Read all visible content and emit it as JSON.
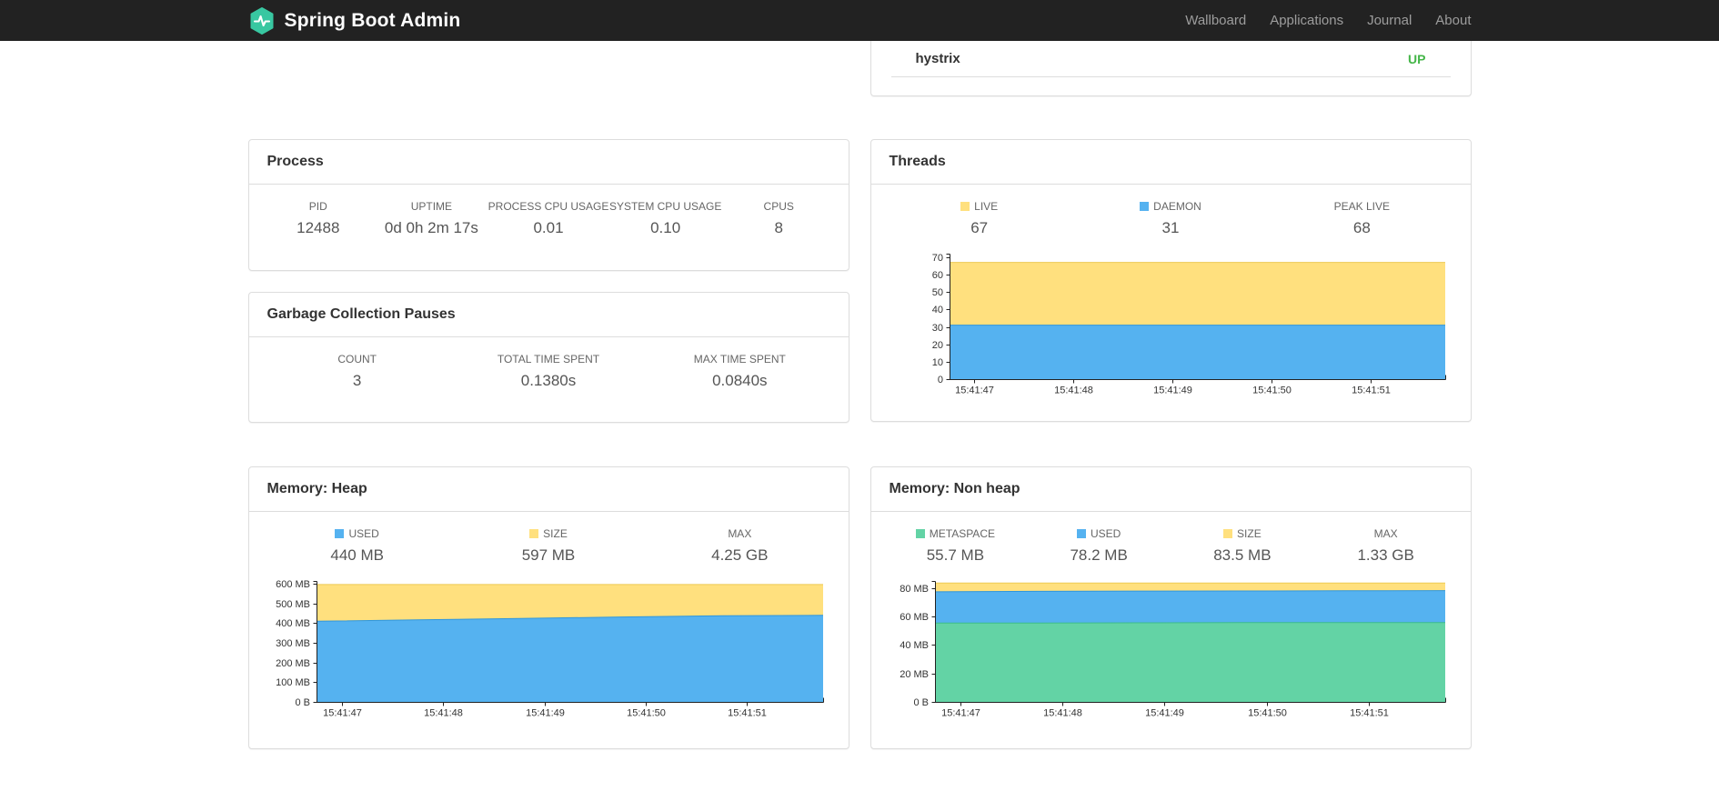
{
  "navbar": {
    "brand": "Spring Boot Admin",
    "items": [
      {
        "label": "Wallboard"
      },
      {
        "label": "Applications"
      },
      {
        "label": "Journal"
      },
      {
        "label": "About"
      }
    ]
  },
  "applications_panel": {
    "app_name": "hystrix",
    "status": "UP"
  },
  "panels": {
    "process": {
      "title": "Process",
      "metrics": [
        {
          "label": "PID",
          "value": "12488"
        },
        {
          "label": "UPTIME",
          "value": "0d 0h 2m 17s"
        },
        {
          "label": "PROCESS CPU USAGE",
          "value": "0.01"
        },
        {
          "label": "SYSTEM CPU USAGE",
          "value": "0.10"
        },
        {
          "label": "CPUS",
          "value": "8"
        }
      ]
    },
    "gc": {
      "title": "Garbage Collection Pauses",
      "metrics": [
        {
          "label": "COUNT",
          "value": "3"
        },
        {
          "label": "TOTAL TIME SPENT",
          "value": "0.1380s"
        },
        {
          "label": "MAX TIME SPENT",
          "value": "0.0840s"
        }
      ]
    },
    "threads": {
      "title": "Threads",
      "legend": [
        {
          "label": "LIVE",
          "value": "67",
          "swatch": "#ffe07e"
        },
        {
          "label": "DAEMON",
          "value": "31",
          "swatch": "#55b2f0"
        },
        {
          "label": "PEAK LIVE",
          "value": "68"
        }
      ]
    },
    "heap": {
      "title": "Memory: Heap",
      "legend": [
        {
          "label": "USED",
          "value": "440 MB",
          "swatch": "#55b2f0"
        },
        {
          "label": "SIZE",
          "value": "597 MB",
          "swatch": "#ffe07e"
        },
        {
          "label": "MAX",
          "value": "4.25 GB"
        }
      ]
    },
    "nonheap": {
      "title": "Memory: Non heap",
      "legend": [
        {
          "label": "METASPACE",
          "value": "55.7 MB",
          "swatch": "#63d3a5"
        },
        {
          "label": "USED",
          "value": "78.2 MB",
          "swatch": "#55b2f0"
        },
        {
          "label": "SIZE",
          "value": "83.5 MB",
          "swatch": "#ffe07e"
        },
        {
          "label": "MAX",
          "value": "1.33 GB"
        }
      ]
    }
  },
  "colors": {
    "status_up": "#45b649",
    "navbar": "#222222",
    "logo_teal": "#38c7a1",
    "chart_yellow": "#ffe07e",
    "chart_blue": "#55b2f0",
    "chart_green": "#63d3a5"
  },
  "chart_data": [
    {
      "id": "threads",
      "type": "area",
      "title": "Threads",
      "legend": [
        "LIVE",
        "DAEMON",
        "PEAK LIVE"
      ],
      "current": {
        "live": 67,
        "daemon": 31,
        "peak_live": 68
      },
      "ylim": [
        0,
        72
      ],
      "y_ticks": [
        {
          "v": 0,
          "label": "0"
        },
        {
          "v": 10,
          "label": "10"
        },
        {
          "v": 20,
          "label": "20"
        },
        {
          "v": 30,
          "label": "30"
        },
        {
          "v": 40,
          "label": "40"
        },
        {
          "v": 50,
          "label": "50"
        },
        {
          "v": 60,
          "label": "60"
        },
        {
          "v": 70,
          "label": "70"
        }
      ],
      "x_tick_fracs": [
        0.05,
        0.25,
        0.45,
        0.65,
        0.85
      ],
      "x_tick_labels": [
        "15:41:47",
        "15:41:48",
        "15:41:49",
        "15:41:50",
        "15:41:51"
      ],
      "x_fracs": [
        0,
        0.2,
        0.4,
        0.6,
        0.8,
        1
      ],
      "series": [
        {
          "name": "LIVE",
          "fill": "#ffe07e",
          "line": "#edca55",
          "cumulative_top": [
            67,
            67,
            67,
            67,
            67,
            67
          ]
        },
        {
          "name": "DAEMON",
          "fill": "#55b2f0",
          "line": "#2f96dc",
          "cumulative_top": [
            31,
            31,
            31,
            31,
            31,
            31
          ]
        }
      ]
    },
    {
      "id": "heap",
      "type": "area",
      "title": "Memory: Heap",
      "legend": [
        "USED",
        "SIZE",
        "MAX"
      ],
      "current": {
        "used": "440 MB",
        "size": "597 MB",
        "max": "4.25 GB"
      },
      "ylim": [
        0,
        615
      ],
      "y_ticks": [
        {
          "v": 0,
          "label": "0 B"
        },
        {
          "v": 100,
          "label": "100 MB"
        },
        {
          "v": 200,
          "label": "200 MB"
        },
        {
          "v": 300,
          "label": "300 MB"
        },
        {
          "v": 400,
          "label": "400 MB"
        },
        {
          "v": 500,
          "label": "500 MB"
        },
        {
          "v": 600,
          "label": "600 MB"
        }
      ],
      "x_tick_fracs": [
        0.05,
        0.25,
        0.45,
        0.65,
        0.85
      ],
      "x_tick_labels": [
        "15:41:47",
        "15:41:48",
        "15:41:49",
        "15:41:50",
        "15:41:51"
      ],
      "x_fracs": [
        0,
        0.2,
        0.4,
        0.6,
        0.8,
        1
      ],
      "series": [
        {
          "name": "SIZE",
          "fill": "#ffe07e",
          "line": "#edca55",
          "cumulative_top": [
            597,
            597,
            597,
            597,
            597,
            597
          ]
        },
        {
          "name": "USED",
          "fill": "#55b2f0",
          "line": "#2f96dc",
          "cumulative_top": [
            410,
            417,
            424,
            432,
            438,
            440
          ]
        }
      ]
    },
    {
      "id": "nonheap",
      "type": "area",
      "title": "Memory: Non heap",
      "legend": [
        "METASPACE",
        "USED",
        "SIZE",
        "MAX"
      ],
      "current": {
        "metaspace": "55.7 MB",
        "used": "78.2 MB",
        "size": "83.5 MB",
        "max": "1.33 GB"
      },
      "ylim": [
        0,
        85
      ],
      "y_ticks": [
        {
          "v": 0,
          "label": "0 B"
        },
        {
          "v": 20,
          "label": "20 MB"
        },
        {
          "v": 40,
          "label": "40 MB"
        },
        {
          "v": 60,
          "label": "60 MB"
        },
        {
          "v": 80,
          "label": "80 MB"
        }
      ],
      "x_tick_fracs": [
        0.05,
        0.25,
        0.45,
        0.65,
        0.85
      ],
      "x_tick_labels": [
        "15:41:47",
        "15:41:48",
        "15:41:49",
        "15:41:50",
        "15:41:51"
      ],
      "x_fracs": [
        0,
        0.2,
        0.4,
        0.6,
        0.8,
        1
      ],
      "series": [
        {
          "name": "SIZE",
          "fill": "#ffe07e",
          "line": "#edca55",
          "cumulative_top": [
            83.5,
            83.5,
            83.5,
            83.5,
            83.5,
            83.5
          ]
        },
        {
          "name": "USED",
          "fill": "#55b2f0",
          "line": "#2f96dc",
          "cumulative_top": [
            77.4,
            77.7,
            77.9,
            78.0,
            78.1,
            78.2
          ]
        },
        {
          "name": "METASPACE",
          "fill": "#63d3a5",
          "line": "#3dbd8a",
          "cumulative_top": [
            55.4,
            55.5,
            55.6,
            55.7,
            55.7,
            55.7
          ]
        }
      ]
    }
  ]
}
